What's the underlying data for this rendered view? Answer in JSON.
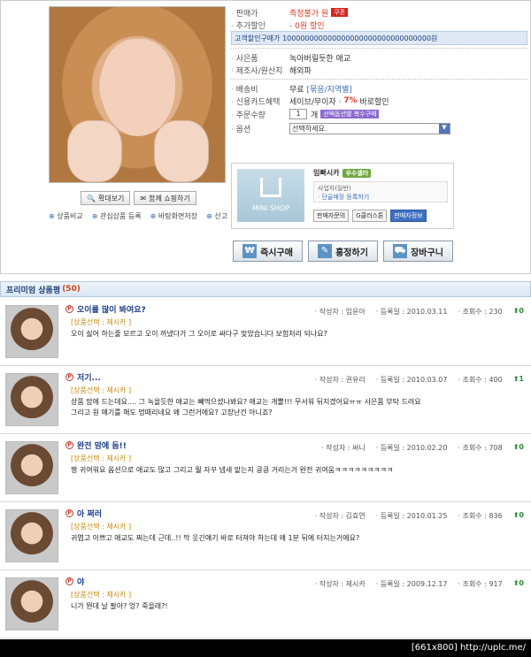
{
  "product": {
    "labels": {
      "seller": "판매가",
      "extra_discount": "추가할인",
      "customer_price": "고객할인구매가",
      "item": "사은품",
      "maker": "제조사/원산지",
      "shipping": "배송비",
      "card": "신용카드혜택",
      "order_qty": "주문수량",
      "option": "옵션"
    },
    "values": {
      "seller": "측정불가 원",
      "seller_badge": "쿠폰",
      "extra_discount": "- 0원 할인",
      "customer_price": "100000000000000000000000000000000원",
      "item": "녹아버릴듯한 애교",
      "maker": "해외파",
      "shipping": "무료",
      "shipping_extra": "[묶음/지역별]",
      "card_text": "세이브/무이자 ·",
      "card_rate": "7%",
      "card_tail": "바로할인",
      "qty": "1",
      "qty_unit": "개",
      "qty_badge": "선택옵션별 복수구매",
      "option_select": "선택하세요."
    },
    "buttons": {
      "zoom": "확대보기",
      "share": "함께 쇼핑하기",
      "compare": "상품비교",
      "wish": "관심상품 등록",
      "desktop": "바탕화면저장",
      "ship": "산고"
    }
  },
  "shop": {
    "minishop": "MINI SHOP",
    "name": "임빠시카",
    "badge": "우수셀러",
    "desc1": "사업자(일반)",
    "desc2": "· 단골매장 등록하기",
    "btn_inquiry": "판매자문의",
    "btn_gclub": "G클러스톤",
    "btn_seller": "판매자정보"
  },
  "actions": {
    "buy": "즉시구매",
    "gift": "흥정하기",
    "cart": "장바구니"
  },
  "reviews_header": {
    "title": "프리미엄 상품평",
    "count": "(50)"
  },
  "reviews": [
    {
      "title": "오이를 많이 봐여요?",
      "author": "· 작성자 : 임윤아",
      "date": "· 등록일 : 2010.03.11",
      "views": "· 조회수 : 230",
      "votes": "0",
      "tag": "[상품선택 : 제시카 ]",
      "text": "오이 싫어 하는줄 모르고 오이 꺼냈다가 그 오이로 싸다구 맞았습니다 보험처리 되나요?"
    },
    {
      "title": "저기...",
      "author": "· 작성자 : 권유리",
      "date": "· 등록일 : 2010.03.07",
      "views": "· 조회수 : 400",
      "votes": "1",
      "tag": "[상품선택 : 제시카 ]",
      "text": "상품 맘에 드는데요.... 그 녹을듯한 애교는 빼먹으셨나봐요? 애교는 개뿔!!! 무서워 뒤지겠어요ㅠㅠ 사은품 부탁 드려요 그리고 원 얘기를 해도 멍때리네요 왜 그런거에요? 고장난건 아니죠?"
    },
    {
      "title": "완전 맘에 듬!!",
      "author": "· 작성자 : 써니",
      "date": "· 등록일 : 2010.02.20",
      "views": "· 조회수 : 708",
      "votes": "0",
      "tag": "[상품선택 : 제시카 ]",
      "text": "짱 귀여워요 옵션으로 애교도 많고 그리고 뭘 자꾸 냄새 맡는지 킁킁 거리는거 완전 귀여움ㅋㅋㅋㅋㅋㅋㅋㅋㅋ"
    },
    {
      "title": "아 쩌러",
      "author": "· 작성자 : 김효연",
      "date": "· 등록일 : 2010.01.25",
      "views": "· 조회수 : 836",
      "votes": "0",
      "tag": "[상품선택 : 제시카 ]",
      "text": "귀엽고 이쁘고 애교도 쩌는데 근데..!! 막 웃긴얘기 바로 터져야 하는데 왜 1분 뒤에 터지는거에요?"
    },
    {
      "title": "야",
      "author": "· 작성자 : 제시카",
      "date": "· 등록일 : 2009.12.17",
      "views": "· 조회수 : 917",
      "votes": "0",
      "tag": "[상품선택 : 제시카 ]",
      "text": "니가 뭔데 날 팔아? 엉? 죽을래?!"
    }
  ],
  "footer": "[661x800] http://uplc.me/"
}
